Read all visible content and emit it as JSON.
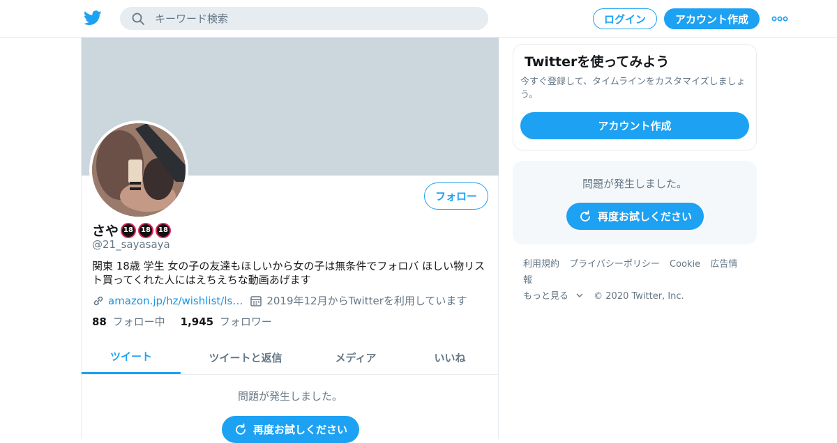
{
  "topbar": {
    "logo_icon": "twitter-bird-icon",
    "search_placeholder": "キーワード検索",
    "login_label": "ログイン",
    "signup_label": "アカウント作成",
    "more_icon": "more-dots-icon"
  },
  "profile": {
    "name": "さや",
    "badges": [
      "18",
      "18",
      "18"
    ],
    "handle": "@21_sayasaya",
    "follow_label": "フォロー",
    "bio": "関東 18歳 学生 女の子の友達もほしいから女の子は無条件でフォロバ ほしい物リスト買ってくれた人にはえちえちな動画あげます",
    "link": "amazon.jp/hz/wishlist/ls…",
    "joined": "2019年12月からTwitterを利用しています",
    "following_count": "88",
    "following_label": "フォロー中",
    "followers_count": "1,945",
    "followers_label": "フォロワー"
  },
  "tabs": [
    {
      "label": "ツイート",
      "active": true
    },
    {
      "label": "ツイートと返信",
      "active": false
    },
    {
      "label": "メディア",
      "active": false
    },
    {
      "label": "いいね",
      "active": false
    }
  ],
  "main_error": {
    "message": "問題が発生しました。",
    "retry_label": "再度お試しください"
  },
  "signup_card": {
    "title": "Twitterを使ってみよう",
    "description": "今すぐ登録して、タイムラインをカスタマイズしましょう。",
    "button_label": "アカウント作成"
  },
  "side_error": {
    "message": "問題が発生しました。",
    "retry_label": "再度お試しください"
  },
  "footer": {
    "links": [
      "利用規約",
      "プライバシーポリシー",
      "Cookie",
      "広告情報"
    ],
    "more_label": "もっと見る",
    "copyright": "© 2020 Twitter, Inc."
  },
  "colors": {
    "accent": "#1da1f2",
    "banner": "#ccd6dd",
    "secondary_text": "#657786"
  }
}
